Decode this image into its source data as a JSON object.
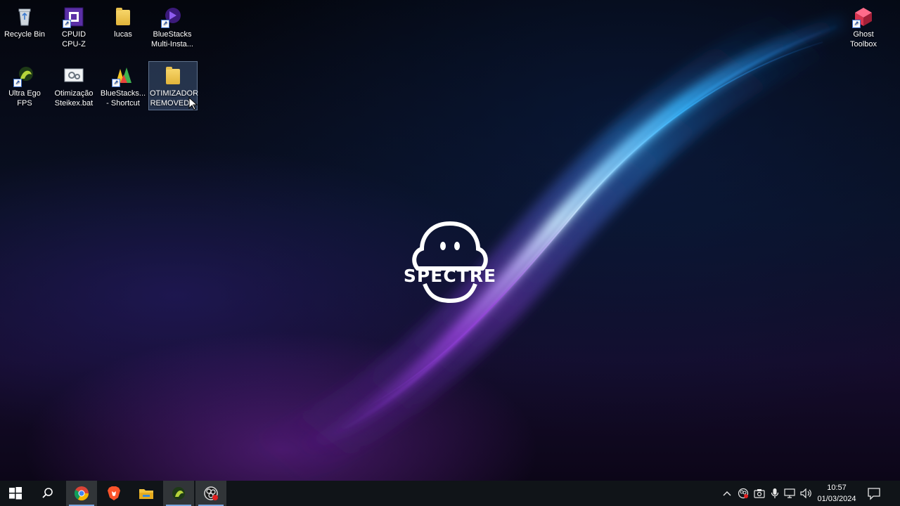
{
  "desktop": {
    "icons": [
      {
        "label": "Recycle Bin",
        "icon": "recycle-bin-icon"
      },
      {
        "label": "CPUID\nCPU-Z",
        "icon": "cpu-z-icon"
      },
      {
        "label": "lucas",
        "icon": "folder-icon"
      },
      {
        "label": "BlueStacks\nMulti-Insta...",
        "icon": "bluestacks-multi-instance-icon"
      },
      {
        "label": "Ultra Ego FPS",
        "icon": "ultra-ego-fps-icon"
      },
      {
        "label": "Otimização\nSteikex.bat",
        "icon": "batch-file-icon"
      },
      {
        "label": "BlueStacks...\n- Shortcut",
        "icon": "bluestacks-icon"
      },
      {
        "label": "OTIMIZADOR\nREMOVED...",
        "icon": "folder-icon",
        "selected": true
      },
      {
        "label": "Ghost\nToolbox",
        "icon": "ghost-toolbox-icon"
      }
    ],
    "wallpaper_logo_text": "SPECTRE",
    "colors": {
      "wave_cyan": "#4fd2ff",
      "wave_purple": "#8a3cd6",
      "background": "#070a16"
    }
  },
  "taskbar": {
    "start": "windows-start-icon",
    "search": "search-icon",
    "apps": [
      {
        "name": "chrome-icon",
        "active": true
      },
      {
        "name": "brave-icon",
        "active": false
      },
      {
        "name": "file-explorer-icon",
        "active": false
      },
      {
        "name": "ultra-ego-fps-icon",
        "active": true
      },
      {
        "name": "obs-icon",
        "active": true
      }
    ],
    "tray": [
      "chevron-up-icon",
      "obs-tray-icon",
      "capture-icon",
      "microphone-icon",
      "network-icon",
      "volume-icon"
    ],
    "time": "10:57",
    "date": "01/03/2024"
  }
}
